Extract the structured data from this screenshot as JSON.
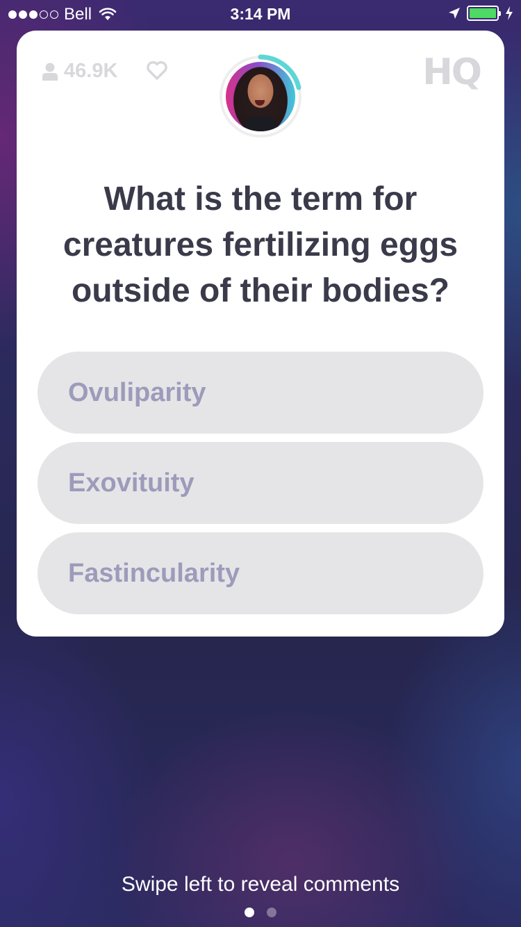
{
  "status_bar": {
    "carrier": "Bell",
    "time": "3:14 PM",
    "signal_bars_filled": 3,
    "signal_bars_total": 5,
    "battery_level_percent": 100,
    "battery_color": "#4cd964"
  },
  "card": {
    "viewer_count": "46.9K",
    "logo": "HQ",
    "timer_color": "#5fd6d6",
    "question": "What is the term for creatures fertilizing eggs outside of their bodies?",
    "answers": [
      {
        "label": "Ovuliparity"
      },
      {
        "label": "Exovituity"
      },
      {
        "label": "Fastincularity"
      }
    ]
  },
  "footer": {
    "swipe_hint": "Swipe left to reveal comments",
    "page_count": 2,
    "active_page": 1
  },
  "colors": {
    "card_bg": "#ffffff",
    "answer_bg": "#e5e5e7",
    "answer_text": "#9d9bbb",
    "question_text": "#3a3a4a"
  }
}
